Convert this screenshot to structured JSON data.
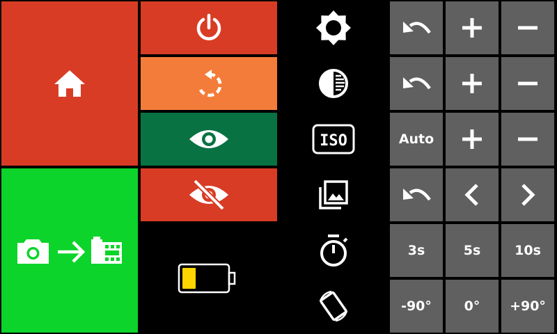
{
  "colors": {
    "home_tile": "#d93c25",
    "capture_tile": "#0cd42a",
    "power_tile": "#d93c25",
    "restart_tile": "#f47c3a",
    "show_tile": "#087242",
    "hide_tile": "#d93c25",
    "grey_button": "#606060",
    "background": "#000000",
    "battery_fill": "#ffd500"
  },
  "battery": {
    "level": 0.3
  },
  "icons": {
    "home": "home-icon",
    "capture": "camera-to-film-icon",
    "power": "power-icon",
    "restart": "restart-icon",
    "show": "eye-icon",
    "hide": "eye-off-icon",
    "battery": "battery-icon",
    "brightness": "brightness-icon",
    "contrast": "contrast-icon",
    "iso": "iso-icon",
    "gallery": "gallery-icon",
    "timer": "timer-icon",
    "rotate": "screen-rotation-icon",
    "undo": "undo-icon",
    "plus": "plus-icon",
    "minus": "minus-icon",
    "prev": "chevron-left-icon",
    "next": "chevron-right-icon"
  },
  "settings": {
    "iso_auto_label": "Auto",
    "timer": {
      "a": "3s",
      "b": "5s",
      "c": "10s"
    },
    "rotation": {
      "a": "-90°",
      "b": "0°",
      "c": "+90°"
    }
  }
}
